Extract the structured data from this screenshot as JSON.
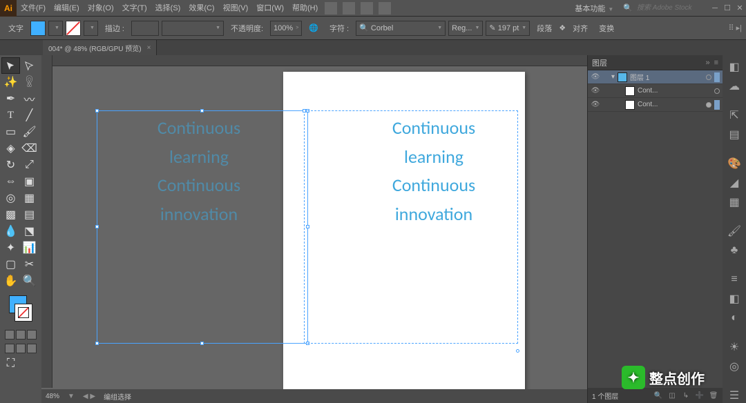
{
  "app": {
    "logo": "Ai"
  },
  "menu": [
    "文件(F)",
    "编辑(E)",
    "对象(O)",
    "文字(T)",
    "选择(S)",
    "效果(C)",
    "视图(V)",
    "窗口(W)",
    "帮助(H)"
  ],
  "workspace_label": "基本功能",
  "stock_placeholder": "搜索 Adobe Stock",
  "ctrl": {
    "tool_label": "文字",
    "fill_hex": "#40b0ff",
    "stroke_label": "描边 :",
    "stroke_pt": "",
    "opacity_label": "不透明度:",
    "opacity_value": "100%",
    "charset_label": "字符 :",
    "font_family": "Corbel",
    "font_style": "Reg...",
    "font_size": "197 pt",
    "para_label": "段落",
    "align_label": "对齐",
    "transform_label": "变换"
  },
  "doc_tab": {
    "title": "004* @ 48% (RGB/GPU 预览)",
    "close": "×"
  },
  "canvas": {
    "text1": "Continuous\nlearning\nContinuous\ninnovation",
    "text2": "Continuous\nlearning\nContinuous\ninnovation"
  },
  "status": {
    "zoom": "48%",
    "group_sel": "编组选择"
  },
  "layers_panel": {
    "title": "图层",
    "items": [
      {
        "name": "图层 1",
        "sel": true,
        "depth": 0,
        "blue": true,
        "expand": "▾"
      },
      {
        "name": "Cont...",
        "sel": false,
        "depth": 1,
        "blue": false
      },
      {
        "name": "Cont...",
        "sel": false,
        "depth": 1,
        "blue": false,
        "target": true
      }
    ],
    "footer": "1 个图层"
  },
  "watermark": {
    "text": "整点创作"
  }
}
